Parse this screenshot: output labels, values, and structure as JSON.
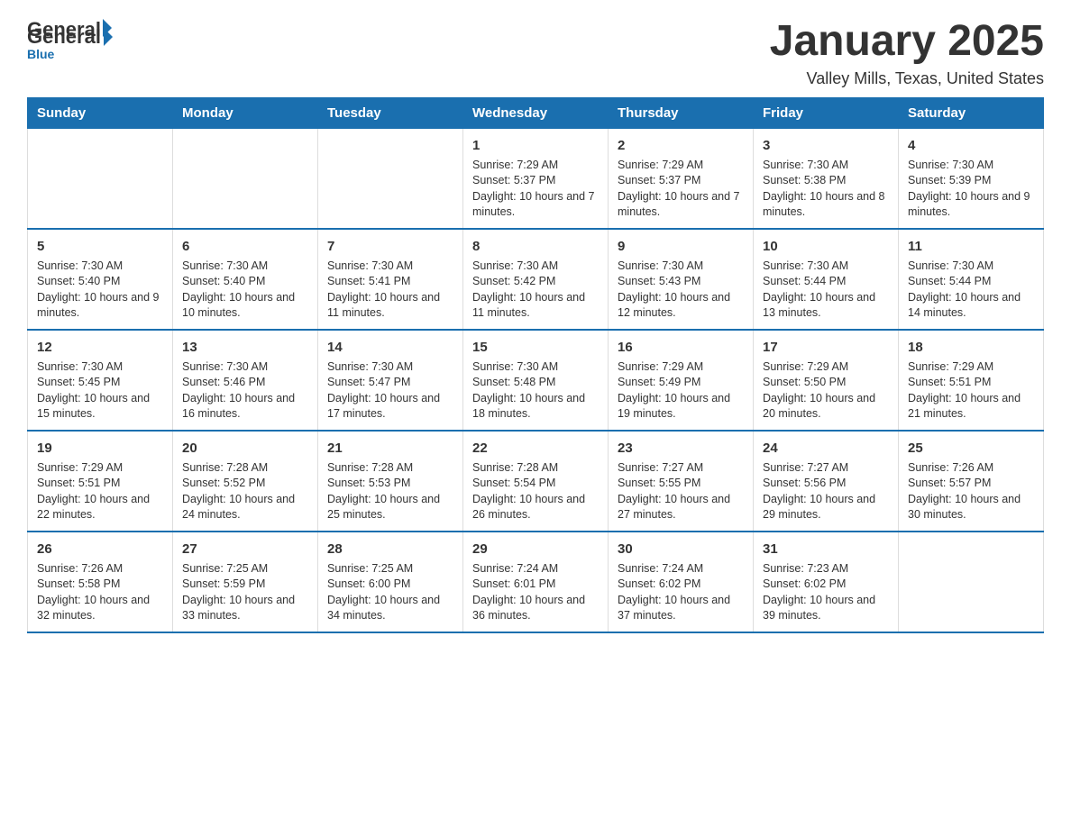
{
  "logo": {
    "general": "General",
    "blue": "Blue",
    "arrow": "▶"
  },
  "title": "January 2025",
  "subtitle": "Valley Mills, Texas, United States",
  "days_of_week": [
    "Sunday",
    "Monday",
    "Tuesday",
    "Wednesday",
    "Thursday",
    "Friday",
    "Saturday"
  ],
  "weeks": [
    [
      {
        "day": "",
        "info": ""
      },
      {
        "day": "",
        "info": ""
      },
      {
        "day": "",
        "info": ""
      },
      {
        "day": "1",
        "info": "Sunrise: 7:29 AM\nSunset: 5:37 PM\nDaylight: 10 hours and 7 minutes."
      },
      {
        "day": "2",
        "info": "Sunrise: 7:29 AM\nSunset: 5:37 PM\nDaylight: 10 hours and 7 minutes."
      },
      {
        "day": "3",
        "info": "Sunrise: 7:30 AM\nSunset: 5:38 PM\nDaylight: 10 hours and 8 minutes."
      },
      {
        "day": "4",
        "info": "Sunrise: 7:30 AM\nSunset: 5:39 PM\nDaylight: 10 hours and 9 minutes."
      }
    ],
    [
      {
        "day": "5",
        "info": "Sunrise: 7:30 AM\nSunset: 5:40 PM\nDaylight: 10 hours and 9 minutes."
      },
      {
        "day": "6",
        "info": "Sunrise: 7:30 AM\nSunset: 5:40 PM\nDaylight: 10 hours and 10 minutes."
      },
      {
        "day": "7",
        "info": "Sunrise: 7:30 AM\nSunset: 5:41 PM\nDaylight: 10 hours and 11 minutes."
      },
      {
        "day": "8",
        "info": "Sunrise: 7:30 AM\nSunset: 5:42 PM\nDaylight: 10 hours and 11 minutes."
      },
      {
        "day": "9",
        "info": "Sunrise: 7:30 AM\nSunset: 5:43 PM\nDaylight: 10 hours and 12 minutes."
      },
      {
        "day": "10",
        "info": "Sunrise: 7:30 AM\nSunset: 5:44 PM\nDaylight: 10 hours and 13 minutes."
      },
      {
        "day": "11",
        "info": "Sunrise: 7:30 AM\nSunset: 5:44 PM\nDaylight: 10 hours and 14 minutes."
      }
    ],
    [
      {
        "day": "12",
        "info": "Sunrise: 7:30 AM\nSunset: 5:45 PM\nDaylight: 10 hours and 15 minutes."
      },
      {
        "day": "13",
        "info": "Sunrise: 7:30 AM\nSunset: 5:46 PM\nDaylight: 10 hours and 16 minutes."
      },
      {
        "day": "14",
        "info": "Sunrise: 7:30 AM\nSunset: 5:47 PM\nDaylight: 10 hours and 17 minutes."
      },
      {
        "day": "15",
        "info": "Sunrise: 7:30 AM\nSunset: 5:48 PM\nDaylight: 10 hours and 18 minutes."
      },
      {
        "day": "16",
        "info": "Sunrise: 7:29 AM\nSunset: 5:49 PM\nDaylight: 10 hours and 19 minutes."
      },
      {
        "day": "17",
        "info": "Sunrise: 7:29 AM\nSunset: 5:50 PM\nDaylight: 10 hours and 20 minutes."
      },
      {
        "day": "18",
        "info": "Sunrise: 7:29 AM\nSunset: 5:51 PM\nDaylight: 10 hours and 21 minutes."
      }
    ],
    [
      {
        "day": "19",
        "info": "Sunrise: 7:29 AM\nSunset: 5:51 PM\nDaylight: 10 hours and 22 minutes."
      },
      {
        "day": "20",
        "info": "Sunrise: 7:28 AM\nSunset: 5:52 PM\nDaylight: 10 hours and 24 minutes."
      },
      {
        "day": "21",
        "info": "Sunrise: 7:28 AM\nSunset: 5:53 PM\nDaylight: 10 hours and 25 minutes."
      },
      {
        "day": "22",
        "info": "Sunrise: 7:28 AM\nSunset: 5:54 PM\nDaylight: 10 hours and 26 minutes."
      },
      {
        "day": "23",
        "info": "Sunrise: 7:27 AM\nSunset: 5:55 PM\nDaylight: 10 hours and 27 minutes."
      },
      {
        "day": "24",
        "info": "Sunrise: 7:27 AM\nSunset: 5:56 PM\nDaylight: 10 hours and 29 minutes."
      },
      {
        "day": "25",
        "info": "Sunrise: 7:26 AM\nSunset: 5:57 PM\nDaylight: 10 hours and 30 minutes."
      }
    ],
    [
      {
        "day": "26",
        "info": "Sunrise: 7:26 AM\nSunset: 5:58 PM\nDaylight: 10 hours and 32 minutes."
      },
      {
        "day": "27",
        "info": "Sunrise: 7:25 AM\nSunset: 5:59 PM\nDaylight: 10 hours and 33 minutes."
      },
      {
        "day": "28",
        "info": "Sunrise: 7:25 AM\nSunset: 6:00 PM\nDaylight: 10 hours and 34 minutes."
      },
      {
        "day": "29",
        "info": "Sunrise: 7:24 AM\nSunset: 6:01 PM\nDaylight: 10 hours and 36 minutes."
      },
      {
        "day": "30",
        "info": "Sunrise: 7:24 AM\nSunset: 6:02 PM\nDaylight: 10 hours and 37 minutes."
      },
      {
        "day": "31",
        "info": "Sunrise: 7:23 AM\nSunset: 6:02 PM\nDaylight: 10 hours and 39 minutes."
      },
      {
        "day": "",
        "info": ""
      }
    ]
  ]
}
